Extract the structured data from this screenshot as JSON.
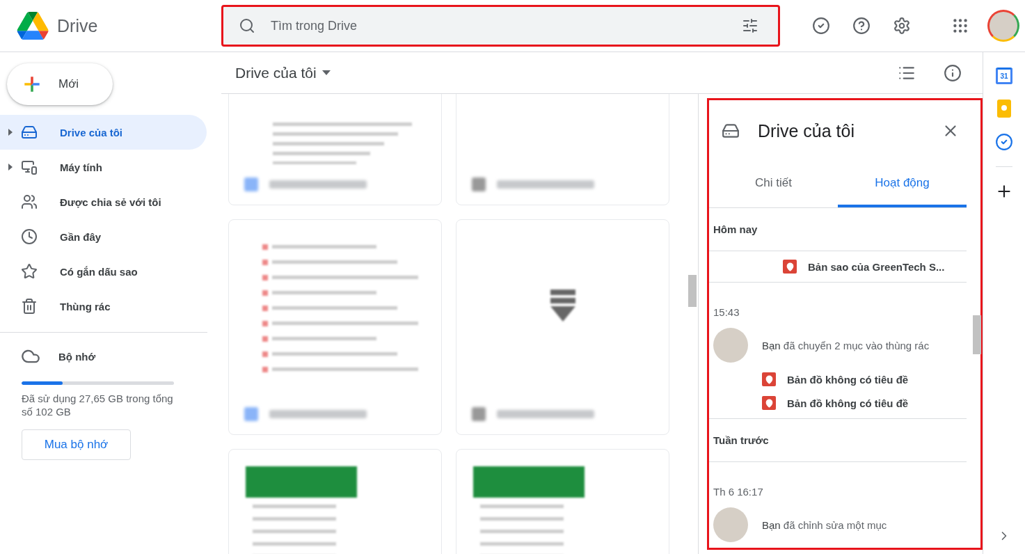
{
  "app": {
    "name": "Drive"
  },
  "search": {
    "placeholder": "Tìm trong Drive",
    "highlighted": true
  },
  "new_button": {
    "label": "Mới"
  },
  "sidebar": {
    "items": [
      {
        "kind": "mydrive",
        "label": "Drive của tôi",
        "selected": true,
        "expandable": true
      },
      {
        "kind": "computers",
        "label": "Máy tính",
        "selected": false,
        "expandable": true
      },
      {
        "kind": "shared",
        "label": "Được chia sẻ với tôi",
        "selected": false,
        "expandable": false
      },
      {
        "kind": "recent",
        "label": "Gần đây",
        "selected": false,
        "expandable": false
      },
      {
        "kind": "starred",
        "label": "Có gắn dấu sao",
        "selected": false,
        "expandable": false
      },
      {
        "kind": "trash",
        "label": "Thùng rác",
        "selected": false,
        "expandable": false
      }
    ]
  },
  "storage": {
    "label": "Bộ nhớ",
    "level": 0.27,
    "usage": "Đã sử dụng 27,65 GB trong tổng số 102 GB",
    "buy_button": "Mua bộ nhớ"
  },
  "content": {
    "title": "Drive của tôi",
    "files": [
      {
        "kind": "doc"
      },
      {
        "kind": "blank"
      },
      {
        "kind": "list"
      },
      {
        "kind": "zip"
      },
      {
        "kind": "sheet"
      },
      {
        "kind": "sheet"
      }
    ]
  },
  "details": {
    "highlighted": true,
    "title": "Drive của tôi",
    "tabs": [
      {
        "label": "Chi tiết",
        "selected": false
      },
      {
        "label": "Hoạt động",
        "selected": true
      }
    ],
    "blocks": [
      {
        "kind": "day",
        "label": "Hôm nay"
      },
      {
        "kind": "event",
        "items": [
          "Bản sao của GreenTech S..."
        ]
      },
      {
        "kind": "event",
        "time": "15:43",
        "text": "**Bạn** đã chuyển 2 mục vào thùng rác",
        "items": [
          "Bản đồ không có tiêu đề",
          "Bản đồ không có tiêu đề"
        ]
      },
      {
        "kind": "day",
        "label": "Tuần trước"
      },
      {
        "kind": "event",
        "time": "Th 6 16:17",
        "text": "**Bạn** đã chỉnh sửa một mục"
      }
    ]
  },
  "side_apps": {
    "calendar_label": "31"
  }
}
